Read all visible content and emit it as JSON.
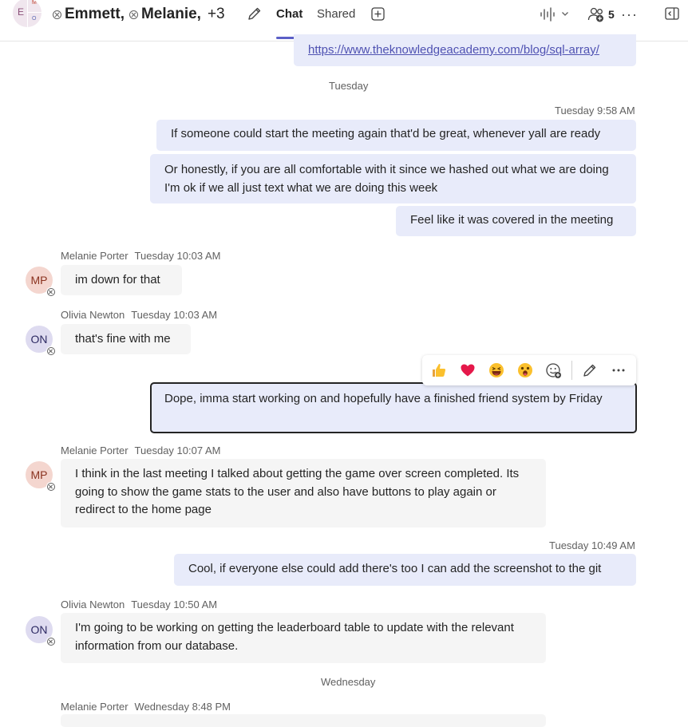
{
  "header": {
    "avatar_letters": {
      "main": "E",
      "top": "M",
      "bottom": "O"
    },
    "participants": [
      {
        "name": "Emmett",
        "sep": ","
      },
      {
        "name": "Melanie",
        "sep": ","
      }
    ],
    "more_count": "+3",
    "tabs": {
      "chat": "Chat",
      "shared": "Shared"
    },
    "people_count": "5",
    "more": "···"
  },
  "messages": {
    "link_text": "https://www.theknowledgeacademy.com/blog/sql-array/",
    "day_tuesday": "Tuesday",
    "ts_958": "Tuesday 9:58 AM",
    "m1": "If someone could start the meeting again that'd be great, whenever yall are ready",
    "m2": "Or honestly, if you are all comfortable with it since we hashed out what we are doing I'm ok if we all just text what we are doing this week",
    "m3": "Feel like it was covered in the meeting",
    "mp1": {
      "name": "Melanie Porter",
      "time": "Tuesday 10:03 AM",
      "initials": "MP",
      "text": "im down for that"
    },
    "on1": {
      "name": "Olivia Newton",
      "time": "Tuesday 10:03 AM",
      "initials": "ON",
      "text": "that's fine with me"
    },
    "m4": "Dope, imma start working on and hopefully have a finished friend system by Friday",
    "mp2": {
      "name": "Melanie Porter",
      "time": "Tuesday 10:07 AM",
      "initials": "MP",
      "text": "I think in the last meeting I talked about getting the game over screen completed. Its going to show the game stats to the user and also have buttons to play again or redirect to the home page"
    },
    "ts_1049": "Tuesday 10:49 AM",
    "m5": "Cool, if everyone else could add there's too I can add the screenshot to the git",
    "on2": {
      "name": "Olivia Newton",
      "time": "Tuesday 10:50 AM",
      "initials": "ON",
      "text": "I'm going to be working on getting the leaderboard table to update with the relevant information from our database."
    },
    "day_wednesday": "Wednesday",
    "mp3": {
      "name": "Melanie Porter",
      "time": "Wednesday 8:48 PM"
    }
  },
  "reactions": [
    "thumbs-up",
    "heart",
    "laugh",
    "surprised"
  ],
  "colors": {
    "accent": "#5b5fc7",
    "outgoing_bubble": "#e8ebfa",
    "incoming_bubble": "#f5f5f5"
  }
}
